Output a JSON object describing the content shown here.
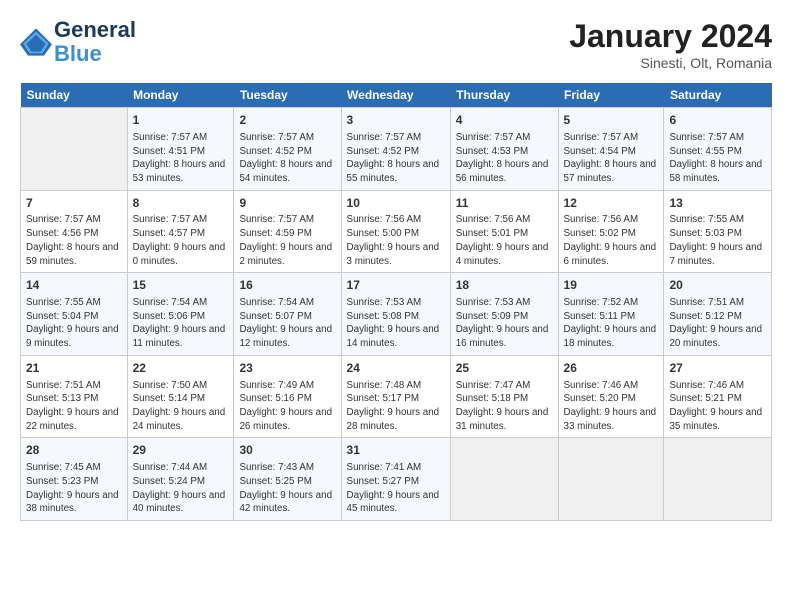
{
  "header": {
    "logo_line1": "General",
    "logo_line2": "Blue",
    "month_title": "January 2024",
    "location": "Sinesti, Olt, Romania"
  },
  "calendar": {
    "days_of_week": [
      "Sunday",
      "Monday",
      "Tuesday",
      "Wednesday",
      "Thursday",
      "Friday",
      "Saturday"
    ],
    "weeks": [
      [
        {
          "day": "",
          "empty": true
        },
        {
          "day": "1",
          "sunrise": "7:57 AM",
          "sunset": "4:51 PM",
          "daylight": "8 hours and 53 minutes."
        },
        {
          "day": "2",
          "sunrise": "7:57 AM",
          "sunset": "4:52 PM",
          "daylight": "8 hours and 54 minutes."
        },
        {
          "day": "3",
          "sunrise": "7:57 AM",
          "sunset": "4:52 PM",
          "daylight": "8 hours and 55 minutes."
        },
        {
          "day": "4",
          "sunrise": "7:57 AM",
          "sunset": "4:53 PM",
          "daylight": "8 hours and 56 minutes."
        },
        {
          "day": "5",
          "sunrise": "7:57 AM",
          "sunset": "4:54 PM",
          "daylight": "8 hours and 57 minutes."
        },
        {
          "day": "6",
          "sunrise": "7:57 AM",
          "sunset": "4:55 PM",
          "daylight": "8 hours and 58 minutes."
        }
      ],
      [
        {
          "day": "7",
          "sunrise": "7:57 AM",
          "sunset": "4:56 PM",
          "daylight": "8 hours and 59 minutes."
        },
        {
          "day": "8",
          "sunrise": "7:57 AM",
          "sunset": "4:57 PM",
          "daylight": "9 hours and 0 minutes."
        },
        {
          "day": "9",
          "sunrise": "7:57 AM",
          "sunset": "4:59 PM",
          "daylight": "9 hours and 2 minutes."
        },
        {
          "day": "10",
          "sunrise": "7:56 AM",
          "sunset": "5:00 PM",
          "daylight": "9 hours and 3 minutes."
        },
        {
          "day": "11",
          "sunrise": "7:56 AM",
          "sunset": "5:01 PM",
          "daylight": "9 hours and 4 minutes."
        },
        {
          "day": "12",
          "sunrise": "7:56 AM",
          "sunset": "5:02 PM",
          "daylight": "9 hours and 6 minutes."
        },
        {
          "day": "13",
          "sunrise": "7:55 AM",
          "sunset": "5:03 PM",
          "daylight": "9 hours and 7 minutes."
        }
      ],
      [
        {
          "day": "14",
          "sunrise": "7:55 AM",
          "sunset": "5:04 PM",
          "daylight": "9 hours and 9 minutes."
        },
        {
          "day": "15",
          "sunrise": "7:54 AM",
          "sunset": "5:06 PM",
          "daylight": "9 hours and 11 minutes."
        },
        {
          "day": "16",
          "sunrise": "7:54 AM",
          "sunset": "5:07 PM",
          "daylight": "9 hours and 12 minutes."
        },
        {
          "day": "17",
          "sunrise": "7:53 AM",
          "sunset": "5:08 PM",
          "daylight": "9 hours and 14 minutes."
        },
        {
          "day": "18",
          "sunrise": "7:53 AM",
          "sunset": "5:09 PM",
          "daylight": "9 hours and 16 minutes."
        },
        {
          "day": "19",
          "sunrise": "7:52 AM",
          "sunset": "5:11 PM",
          "daylight": "9 hours and 18 minutes."
        },
        {
          "day": "20",
          "sunrise": "7:51 AM",
          "sunset": "5:12 PM",
          "daylight": "9 hours and 20 minutes."
        }
      ],
      [
        {
          "day": "21",
          "sunrise": "7:51 AM",
          "sunset": "5:13 PM",
          "daylight": "9 hours and 22 minutes."
        },
        {
          "day": "22",
          "sunrise": "7:50 AM",
          "sunset": "5:14 PM",
          "daylight": "9 hours and 24 minutes."
        },
        {
          "day": "23",
          "sunrise": "7:49 AM",
          "sunset": "5:16 PM",
          "daylight": "9 hours and 26 minutes."
        },
        {
          "day": "24",
          "sunrise": "7:48 AM",
          "sunset": "5:17 PM",
          "daylight": "9 hours and 28 minutes."
        },
        {
          "day": "25",
          "sunrise": "7:47 AM",
          "sunset": "5:18 PM",
          "daylight": "9 hours and 31 minutes."
        },
        {
          "day": "26",
          "sunrise": "7:46 AM",
          "sunset": "5:20 PM",
          "daylight": "9 hours and 33 minutes."
        },
        {
          "day": "27",
          "sunrise": "7:46 AM",
          "sunset": "5:21 PM",
          "daylight": "9 hours and 35 minutes."
        }
      ],
      [
        {
          "day": "28",
          "sunrise": "7:45 AM",
          "sunset": "5:23 PM",
          "daylight": "9 hours and 38 minutes."
        },
        {
          "day": "29",
          "sunrise": "7:44 AM",
          "sunset": "5:24 PM",
          "daylight": "9 hours and 40 minutes."
        },
        {
          "day": "30",
          "sunrise": "7:43 AM",
          "sunset": "5:25 PM",
          "daylight": "9 hours and 42 minutes."
        },
        {
          "day": "31",
          "sunrise": "7:41 AM",
          "sunset": "5:27 PM",
          "daylight": "9 hours and 45 minutes."
        },
        {
          "day": "",
          "empty": true
        },
        {
          "day": "",
          "empty": true
        },
        {
          "day": "",
          "empty": true
        }
      ]
    ]
  }
}
